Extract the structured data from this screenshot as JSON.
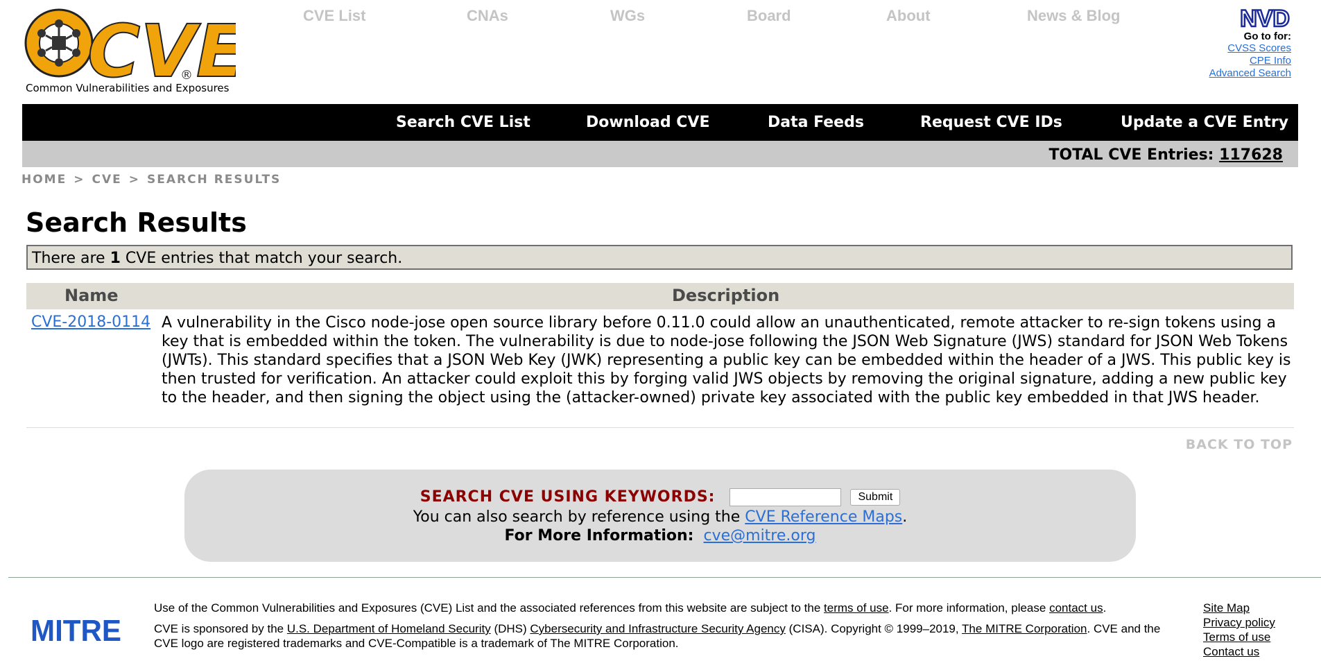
{
  "header": {
    "logo_text": "CVE",
    "logo_caption": "Common Vulnerabilities and Exposures",
    "top_nav": [
      "CVE List",
      "CNAs",
      "WGs",
      "Board",
      "About",
      "News & Blog"
    ],
    "nvd": {
      "logo_text": "NVD",
      "goto_label": "Go to for:",
      "links": [
        "CVSS Scores",
        "CPE Info",
        "Advanced Search"
      ]
    }
  },
  "main_nav": [
    "Search CVE List",
    "Download CVE",
    "Data Feeds",
    "Request CVE IDs",
    "Update a CVE Entry"
  ],
  "total": {
    "label": "TOTAL CVE Entries:",
    "count": "117628"
  },
  "breadcrumb": [
    "HOME",
    ">",
    "CVE",
    ">",
    "SEARCH RESULTS"
  ],
  "results": {
    "title": "Search Results",
    "match_prefix": "There are",
    "match_count": "1",
    "match_suffix": "CVE entries that match your search.",
    "columns": [
      "Name",
      "Description"
    ],
    "rows": [
      {
        "name": "CVE-2018-0114",
        "description": "A vulnerability in the Cisco node-jose open source library before 0.11.0 could allow an unauthenticated, remote attacker to re-sign tokens using a key that is embedded within the token. The vulnerability is due to node-jose following the JSON Web Signature (JWS) standard for JSON Web Tokens (JWTs). This standard specifies that a JSON Web Key (JWK) representing a public key can be embedded within the header of a JWS. This public key is then trusted for verification. An attacker could exploit this by forging valid JWS objects by removing the original signature, adding a new public key to the header, and then signing the object using the (attacker-owned) private key associated with the public key embedded in that JWS header."
      }
    ],
    "back_to_top": "BACK TO TOP"
  },
  "search_panel": {
    "keyword_label": "SEARCH CVE USING KEYWORDS:",
    "keyword_value": "",
    "submit_label": "Submit",
    "ref_prefix": "You can also search by reference using the",
    "ref_link": "CVE Reference Maps",
    "ref_suffix": ".",
    "info_label": "For More Information:",
    "info_email": "cve@mitre.org"
  },
  "footer": {
    "logo_text": "MITRE",
    "p1_a": "Use of the Common Vulnerabilities and Exposures (CVE) List and the associated references from this website are subject to the",
    "p1_link1": "terms of use",
    "p1_b": ". For more information, please",
    "p1_link2": "contact us",
    "p1_c": ".",
    "p2_a": "CVE is sponsored by the",
    "p2_link1": "U.S. Department of Homeland Security",
    "p2_b": "(DHS)",
    "p2_link2": "Cybersecurity and Infrastructure Security Agency",
    "p2_c": "(CISA). Copyright © 1999–2019,",
    "p2_link3": "The MITRE Corporation",
    "p2_d": ". CVE and the CVE logo are registered trademarks and CVE-Compatible is a trademark of The MITRE Corporation.",
    "links": [
      "Site Map",
      "Privacy policy",
      "Terms of use",
      "Contact us"
    ]
  },
  "colors": {
    "logo_orange": "#f0a30a",
    "nav_black": "#000000",
    "header_tan": "#e0ddd4",
    "link_blue": "#2a6fd6",
    "keyword_red": "#8b0000",
    "mitre_blue": "#1f57c4"
  }
}
